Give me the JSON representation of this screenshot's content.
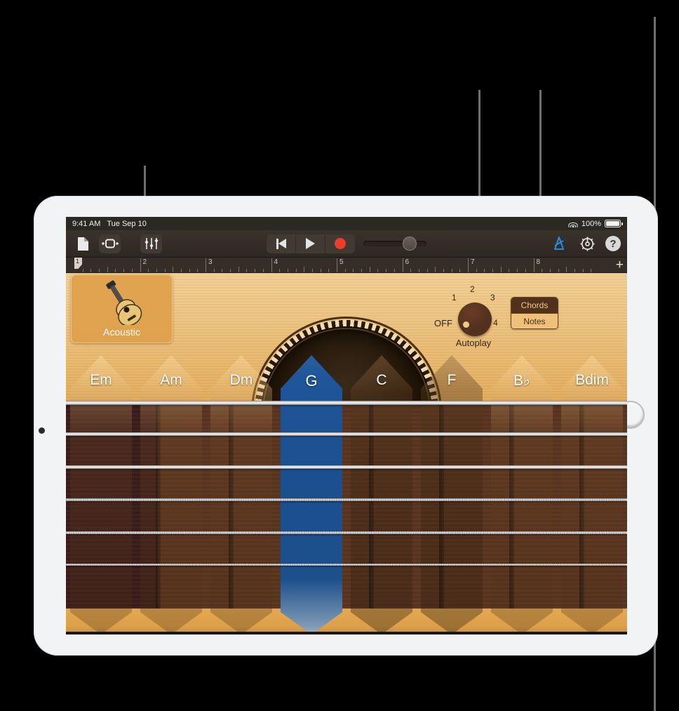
{
  "status_bar": {
    "time": "9:41 AM",
    "date": "Tue Sep 10",
    "battery_percent": "100%",
    "wifi_icon": "wifi-icon",
    "battery_icon": "battery-icon"
  },
  "toolbar": {
    "my_songs_icon": "document-icon",
    "browser_icon": "track-view-icon",
    "mixer_icon": "mixer-sliders-icon",
    "rewind_icon": "go-to-beginning-icon",
    "play_icon": "play-icon",
    "record_icon": "record-icon",
    "master_volume_label": "master-volume-slider",
    "metronome_icon": "metronome-icon",
    "settings_icon": "gear-icon",
    "help_label": "?",
    "metronome_color": "#2e86de"
  },
  "ruler": {
    "bars": [
      "1",
      "2",
      "3",
      "4",
      "5",
      "6",
      "7",
      "8"
    ],
    "playhead_bar": "1",
    "add_track_label": "+"
  },
  "instrument": {
    "name": "Acoustic",
    "icon": "acoustic-guitar-icon"
  },
  "autoplay": {
    "label": "Autoplay",
    "off_label": "OFF",
    "positions": [
      "1",
      "2",
      "3",
      "4"
    ],
    "selected": "OFF"
  },
  "mode_toggle": {
    "chords_label": "Chords",
    "notes_label": "Notes",
    "selected": "Chords"
  },
  "chords": [
    {
      "name": "Em",
      "selected": false,
      "shade": "light"
    },
    {
      "name": "Am",
      "selected": false,
      "shade": "light"
    },
    {
      "name": "Dm",
      "selected": false,
      "shade": "light"
    },
    {
      "name": "G",
      "selected": true,
      "shade": "light"
    },
    {
      "name": "C",
      "selected": false,
      "shade": "dark"
    },
    {
      "name": "F",
      "selected": false,
      "shade": "dark"
    },
    {
      "name": "B♭",
      "selected": false,
      "shade": "light"
    },
    {
      "name": "Bdim",
      "selected": false,
      "shade": "light"
    }
  ],
  "strings": {
    "count": 6,
    "names": [
      "string-6",
      "string-5",
      "string-4",
      "string-3",
      "string-2",
      "string-1"
    ]
  },
  "colors": {
    "selected_chord": "#1f5699",
    "soundboard": "#eab96a",
    "fretboard": "#5a3420",
    "toolbar_bg": "#3a332c"
  }
}
